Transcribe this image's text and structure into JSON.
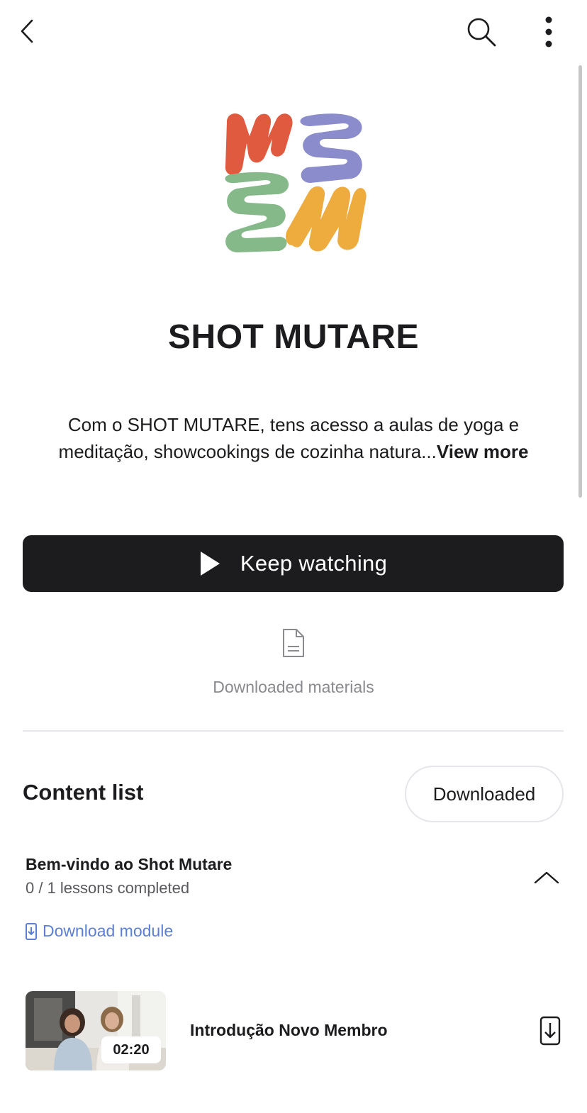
{
  "header": {
    "back_icon": "chevron-left-icon",
    "search_icon": "search-icon",
    "more_icon": "more-vertical-icon"
  },
  "course": {
    "logo": "shot-mutare-logo",
    "title": "SHOT MUTARE",
    "description": "Com o SHOT MUTARE, tens acesso a aulas de yoga e meditação, showcookings de cozinha natura...",
    "view_more": "View more"
  },
  "actions": {
    "keep_watching": "Keep watching",
    "downloaded_materials": "Downloaded materials"
  },
  "content_list": {
    "title": "Content list",
    "filter_label": "Downloaded",
    "modules": [
      {
        "title": "Bem-vindo ao Shot Mutare",
        "progress": "0 / 1 lessons completed",
        "download_label": "Download module",
        "expanded": true,
        "lessons": [
          {
            "title": "Introdução Novo Membro",
            "duration": "02:20"
          }
        ]
      }
    ]
  },
  "colors": {
    "primary_button": "#1c1c1e",
    "link": "#5b7fd6",
    "logo_red": "#e05a3f",
    "logo_purple": "#8a8ccc",
    "logo_green": "#86b98a",
    "logo_yellow": "#eeab3e"
  }
}
